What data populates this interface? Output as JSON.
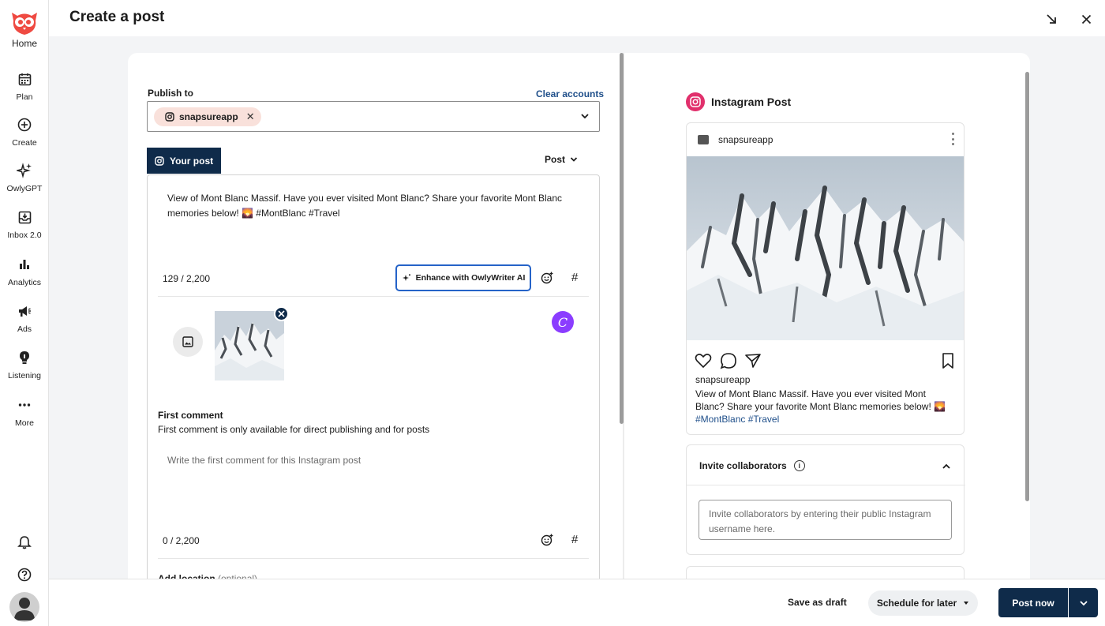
{
  "header": {
    "title": "Create a post"
  },
  "sidebar": {
    "items": [
      {
        "label": "Home",
        "icon": "owl-logo-icon"
      },
      {
        "label": "Plan",
        "icon": "calendar-icon"
      },
      {
        "label": "Create",
        "icon": "plus-circle-icon"
      },
      {
        "label": "OwlyGPT",
        "icon": "sparkles-icon"
      },
      {
        "label": "Inbox 2.0",
        "icon": "inbox-icon"
      },
      {
        "label": "Analytics",
        "icon": "bar-chart-icon"
      },
      {
        "label": "Ads",
        "icon": "megaphone-icon"
      },
      {
        "label": "Listening",
        "icon": "lightbulb-icon"
      },
      {
        "label": "More",
        "icon": "more-icon"
      }
    ]
  },
  "editor": {
    "publish_label": "Publish to",
    "clear_accounts": "Clear accounts",
    "account_chip": "snapsureapp",
    "tab_label": "Your post",
    "post_type": "Post",
    "post_text": "View of Mont Blanc Massif. Have you ever visited Mont Blanc? Share your favorite Mont Blanc memories below! 🌄 #MontBlanc #Travel",
    "char_count": "129 / 2,200",
    "enhance_label": "Enhance with OwlyWriter AI",
    "hash_symbol": "#",
    "canva_letter": "C",
    "first_comment_title": "First comment",
    "first_comment_note": "First comment is only available for direct publishing and for posts",
    "first_comment_placeholder": "Write the first comment for this Instagram post",
    "first_comment_count": "0 / 2,200",
    "location_label": "Add location",
    "location_optional": "(optional)"
  },
  "preview": {
    "title": "Instagram Post",
    "username": "snapsureapp",
    "caption_username": "snapsureapp",
    "caption_text": "View of Mont Blanc Massif. Have you ever visited Mont Blanc? Share your favorite Mont Blanc memories below! 🌄",
    "caption_tags": "#MontBlanc #Travel",
    "collab_title": "Invite collaborators",
    "collab_placeholder": "Invite collaborators by entering their public Instagram username here."
  },
  "footer": {
    "save_draft": "Save as draft",
    "schedule": "Schedule for later",
    "post_now": "Post now"
  },
  "colors": {
    "primary": "#0f2b4a",
    "accent_blue": "#2563c8",
    "instagram": "#e1306c",
    "chip_bg": "#f9e1db",
    "canva": "#8b3dff",
    "owl_red": "#ef4a42"
  }
}
